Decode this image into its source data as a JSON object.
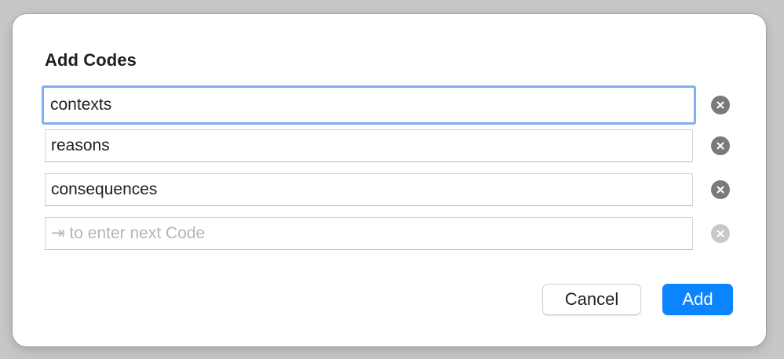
{
  "dialog": {
    "title": "Add Codes"
  },
  "codes": [
    {
      "value": "contexts",
      "clear_icon": "clear-circle-icon"
    },
    {
      "value": "reasons",
      "clear_icon": "clear-circle-icon"
    },
    {
      "value": "consequences",
      "clear_icon": "clear-circle-icon"
    }
  ],
  "new_code": {
    "value": "",
    "placeholder": "⇥ to enter next Code",
    "clear_icon": "clear-circle-icon"
  },
  "buttons": {
    "cancel_label": "Cancel",
    "add_label": "Add"
  },
  "colors": {
    "accent": "#0b84ff",
    "focus_ring": "#80aef0",
    "clear_icon": "#7a7a7a",
    "clear_icon_disabled": "#c8c8c8"
  }
}
